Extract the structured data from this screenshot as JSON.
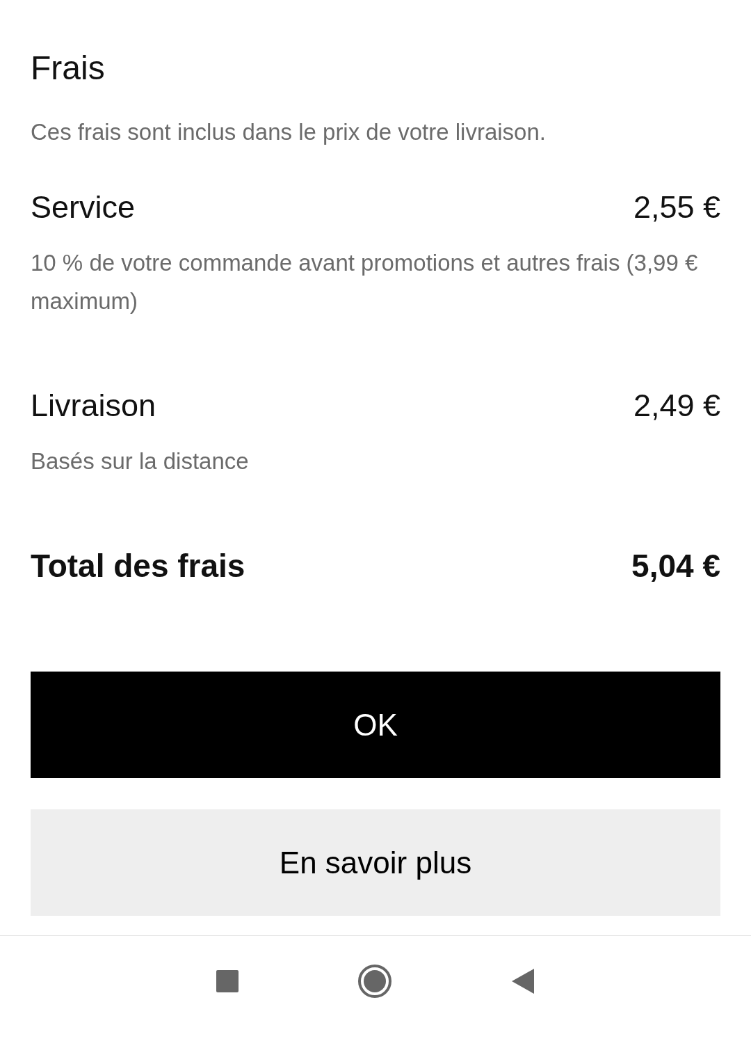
{
  "title": "Frais",
  "subtitle": "Ces frais sont inclus dans le prix de votre livraison.",
  "fees": [
    {
      "label": "Service",
      "price": "2,55 €",
      "description": "10 % de votre commande avant promotions et autres frais (3,99 € maximum)"
    },
    {
      "label": "Livraison",
      "price": "2,49 €",
      "description": "Basés sur la distance"
    }
  ],
  "total": {
    "label": "Total des frais",
    "price": "5,04 €"
  },
  "buttons": [
    {
      "label": "OK",
      "kind": "primary"
    },
    {
      "label": "En savoir plus",
      "kind": "secondary"
    }
  ]
}
